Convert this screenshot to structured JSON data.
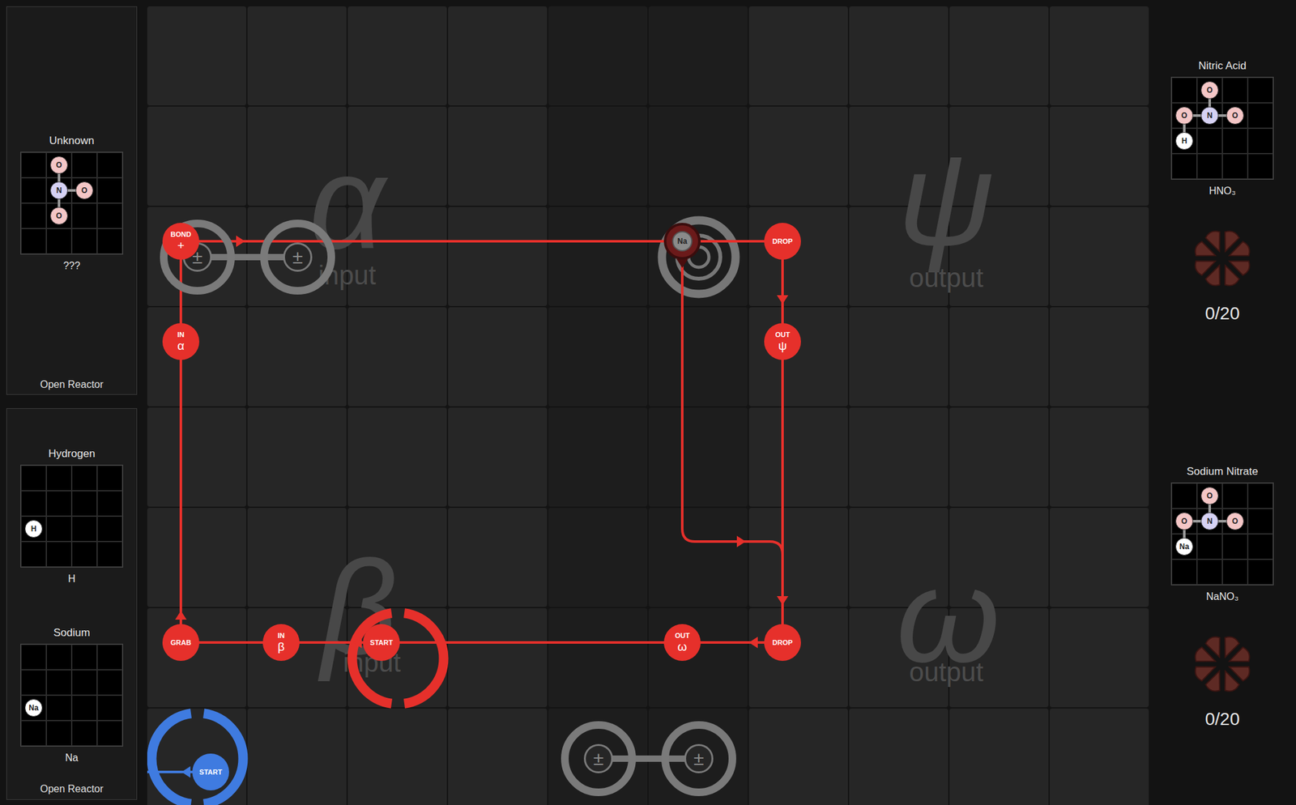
{
  "left_panels": [
    {
      "molecules": [
        {
          "name": "Unknown",
          "formula": "???",
          "atoms": [
            {
              "symbol": "O",
              "color": "#f4c6c6"
            },
            {
              "symbol": "N",
              "color": "#d6d2f4"
            },
            {
              "symbol": "O",
              "color": "#f4c6c6"
            },
            {
              "symbol": "O",
              "color": "#f4c6c6"
            }
          ],
          "bonds": [
            [
              0,
              1
            ],
            [
              1,
              2
            ],
            [
              1,
              3
            ]
          ]
        }
      ],
      "footer": "Open Reactor"
    },
    {
      "molecules": [
        {
          "name": "Hydrogen",
          "formula": "H",
          "atoms": [
            {
              "symbol": "H",
              "color": "#ffffff"
            }
          ],
          "bonds": []
        },
        {
          "name": "Sodium",
          "formula": "Na",
          "atoms": [
            {
              "symbol": "Na",
              "color": "#ffffff"
            }
          ],
          "bonds": []
        }
      ],
      "footer": "Open Reactor"
    }
  ],
  "outputs": [
    {
      "name": "Nitric Acid",
      "formula": "HNO₃",
      "count": "0/20",
      "atoms": [
        {
          "symbol": "O",
          "color": "#f4c6c6"
        },
        {
          "symbol": "O",
          "color": "#f4c6c6"
        },
        {
          "symbol": "N",
          "color": "#d6d2f4"
        },
        {
          "symbol": "O",
          "color": "#f4c6c6"
        },
        {
          "symbol": "H",
          "color": "#ffffff"
        }
      ],
      "bonds": [
        [
          0,
          2
        ],
        [
          1,
          2
        ],
        [
          2,
          3
        ],
        [
          1,
          4
        ]
      ]
    },
    {
      "name": "Sodium Nitrate",
      "formula": "NaNO₃",
      "count": "0/20",
      "atoms": [
        {
          "symbol": "O",
          "color": "#f4c6c6"
        },
        {
          "symbol": "O",
          "color": "#f4c6c6"
        },
        {
          "symbol": "N",
          "color": "#d6d2f4"
        },
        {
          "symbol": "O",
          "color": "#f4c6c6"
        },
        {
          "symbol": "Na",
          "color": "#ffffff"
        }
      ],
      "bonds": [
        [
          0,
          2
        ],
        [
          1,
          2
        ],
        [
          2,
          3
        ],
        [
          1,
          4
        ]
      ]
    }
  ],
  "regions": [
    {
      "letter": "α",
      "label": "input"
    },
    {
      "letter": "ψ",
      "label": "output"
    },
    {
      "letter": "β",
      "label": "input"
    },
    {
      "letter": "ω",
      "label": "output"
    }
  ],
  "bonders": [
    {
      "symbol": "±"
    },
    {
      "symbol": "±"
    },
    {
      "symbol": "±"
    },
    {
      "symbol": "±"
    }
  ],
  "commands": [
    {
      "kind": "instruction",
      "top": "BOND",
      "sub": "+",
      "color": "#e6302b"
    },
    {
      "kind": "instruction",
      "top": "IN",
      "sub": "α",
      "color": "#e6302b"
    },
    {
      "kind": "instruction",
      "top": "GRAB",
      "color": "#e6302b"
    },
    {
      "kind": "instruction",
      "top": "IN",
      "sub": "β",
      "color": "#e6302b"
    },
    {
      "kind": "start",
      "top": "START",
      "color": "#e6302b"
    },
    {
      "kind": "instruction",
      "top": "OUT",
      "sub": "ω",
      "color": "#e6302b"
    },
    {
      "kind": "instruction",
      "top": "DROP",
      "color": "#e6302b"
    },
    {
      "kind": "sensor",
      "top": "Na",
      "color": "#6b1a1a"
    },
    {
      "kind": "instruction",
      "top": "DROP",
      "color": "#e6302b"
    },
    {
      "kind": "instruction",
      "top": "OUT",
      "sub": "ψ",
      "color": "#e6302b"
    },
    {
      "kind": "start",
      "top": "START",
      "color": "#3f7be0"
    }
  ]
}
